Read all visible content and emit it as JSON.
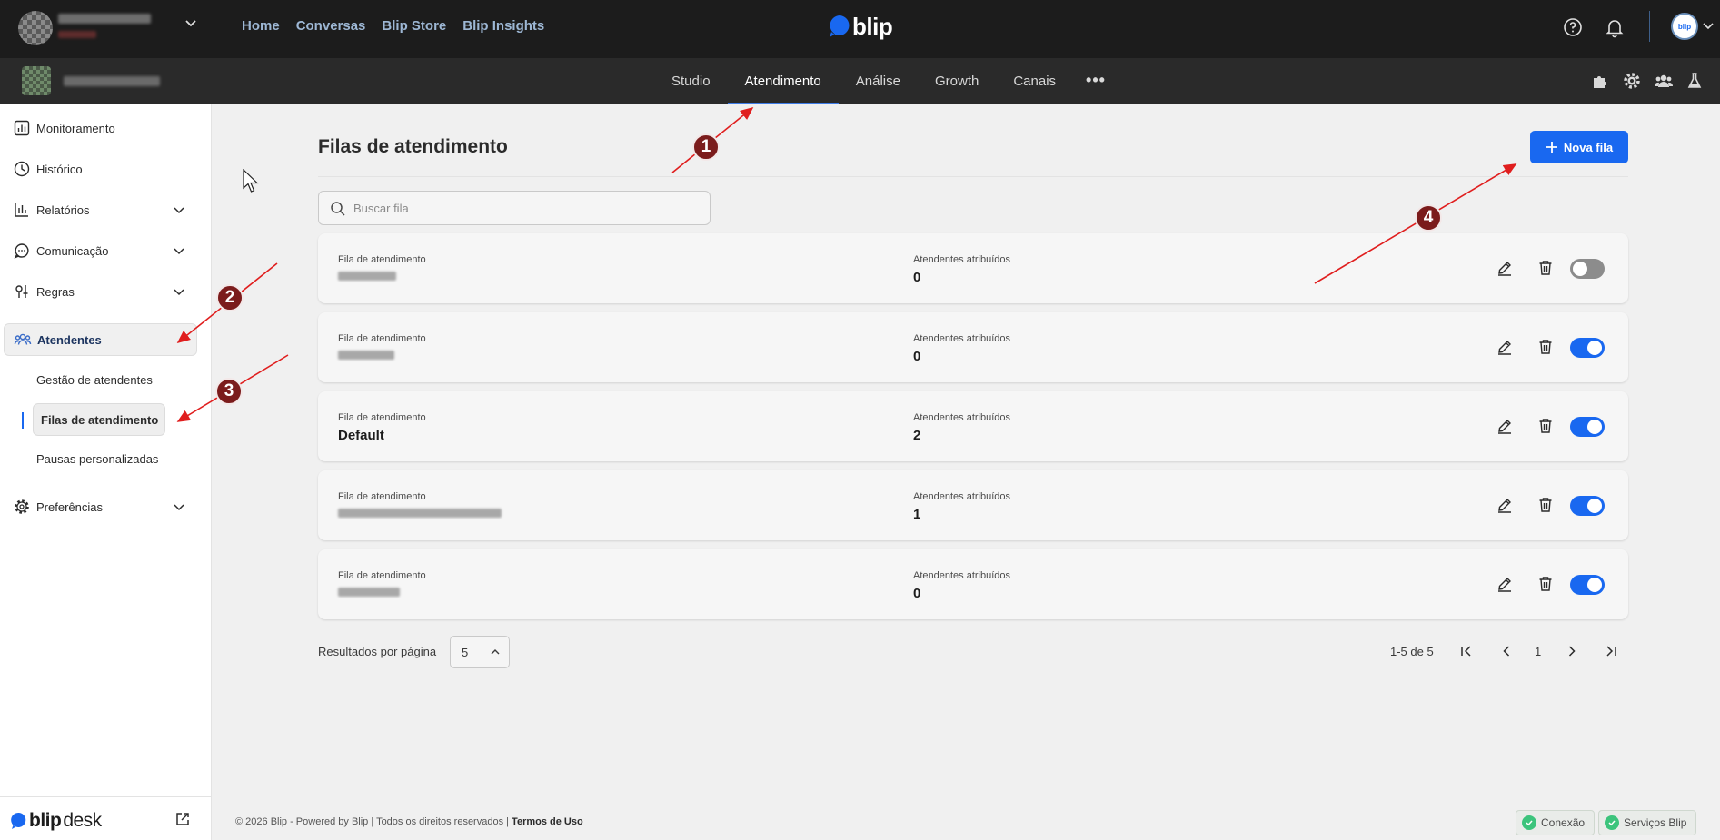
{
  "topbar": {
    "nav": [
      "Home",
      "Conversas",
      "Blip Store",
      "Blip Insights"
    ],
    "brand": "blip",
    "avatar_text": "blip"
  },
  "subbar": {
    "tabs": [
      "Studio",
      "Atendimento",
      "Análise",
      "Growth",
      "Canais"
    ],
    "active_tab": "Atendimento",
    "more": "•••"
  },
  "sidebar": {
    "items": [
      {
        "label": "Monitoramento"
      },
      {
        "label": "Histórico"
      },
      {
        "label": "Relatórios"
      },
      {
        "label": "Comunicação"
      },
      {
        "label": "Regras"
      },
      {
        "label": "Atendentes"
      },
      {
        "label": "Preferências"
      }
    ],
    "subitems": [
      "Gestão de atendentes",
      "Filas de atendimento",
      "Pausas personalizadas"
    ],
    "logo_bold": "blip",
    "logo_light": "desk"
  },
  "main": {
    "title": "Filas de atendimento",
    "new_button": "Nova fila",
    "search_placeholder": "Buscar fila",
    "col_queue": "Fila de atendimento",
    "col_agents": "Atendentes atribuídos",
    "rows": [
      {
        "name": "",
        "agents": "0",
        "enabled": false
      },
      {
        "name": "",
        "agents": "0",
        "enabled": true
      },
      {
        "name": "Default",
        "agents": "2",
        "enabled": true
      },
      {
        "name": "",
        "agents": "1",
        "enabled": true
      },
      {
        "name": "",
        "agents": "0",
        "enabled": true
      }
    ],
    "rpp_label": "Resultados por página",
    "rpp_value": "5",
    "range": "1-5 de 5",
    "page": "1"
  },
  "footer": {
    "text": "© 2026 Blip - Powered by Blip | Todos os direitos reservados | ",
    "link": "Termos de Uso"
  },
  "status": [
    "Conexão",
    "Serviços Blip"
  ],
  "annotations": [
    "1",
    "2",
    "3",
    "4"
  ],
  "colors": {
    "accent": "#1968f0",
    "annotation": "#7b1c1c",
    "arrow": "#e01e1e"
  }
}
